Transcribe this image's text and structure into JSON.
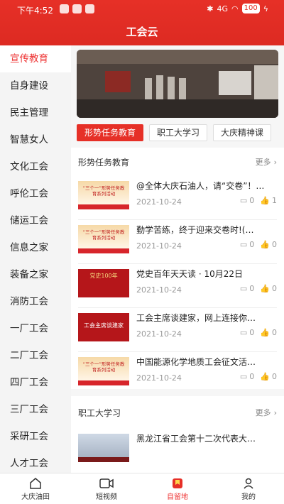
{
  "statusbar": {
    "time": "下午4:52",
    "signal": "4G",
    "battery": "100"
  },
  "app": {
    "title": "工会云"
  },
  "sidebar": {
    "items": [
      {
        "label": "宣传教育",
        "active": true
      },
      {
        "label": "自身建设"
      },
      {
        "label": "民主管理"
      },
      {
        "label": "智慧女人"
      },
      {
        "label": "文化工会"
      },
      {
        "label": "呼伦工会"
      },
      {
        "label": "储运工会"
      },
      {
        "label": "信息之家"
      },
      {
        "label": "装备之家"
      },
      {
        "label": "消防工会"
      },
      {
        "label": "一厂工会"
      },
      {
        "label": "二厂工会"
      },
      {
        "label": "四厂工会"
      },
      {
        "label": "三厂工会"
      },
      {
        "label": "采研工会"
      },
      {
        "label": "人才工会"
      }
    ]
  },
  "tabs": [
    {
      "label": "形势任务教育",
      "active": true
    },
    {
      "label": "职工大学习"
    },
    {
      "label": "大庆精神课"
    }
  ],
  "sections": [
    {
      "title": "形势任务教育",
      "more": "更多",
      "items": [
        {
          "headline": "@全体大庆石油人，请“交卷”！…",
          "date": "2021-10-24",
          "comments": "0",
          "likes": "1",
          "thumb_text": "“三个一”形势任务教育系列活动"
        },
        {
          "headline": "勤学苦练，终于迎来交卷时!(…",
          "date": "2021-10-24",
          "comments": "0",
          "likes": "0",
          "thumb_text": "“三个一”形势任务教育系列活动"
        },
        {
          "headline": "党史百年天天读 · 10月22日",
          "date": "2021-10-24",
          "comments": "0",
          "likes": "0",
          "thumb_text": "党史100年"
        },
        {
          "headline": "工会主席谈建家，网上连接你…",
          "date": "2021-10-24",
          "comments": "0",
          "likes": "0",
          "thumb_text": "工会主席谈建家"
        },
        {
          "headline": "中国能源化学地质工会征文活…",
          "date": "2021-10-24",
          "comments": "0",
          "likes": "0",
          "thumb_text": "“三个一”形势任务教育系列活动"
        }
      ]
    },
    {
      "title": "职工大学习",
      "more": "更多",
      "items": [
        {
          "headline": "黑龙江省工会第十二次代表大…",
          "date": "",
          "comments": "",
          "likes": ""
        }
      ]
    }
  ],
  "tabbar": [
    {
      "label": "大庆油田",
      "icon": "home-icon"
    },
    {
      "label": "短视频",
      "icon": "video-icon"
    },
    {
      "label": "自留地",
      "icon": "bookmark-icon",
      "active": true
    },
    {
      "label": "我的",
      "icon": "person-icon"
    }
  ]
}
